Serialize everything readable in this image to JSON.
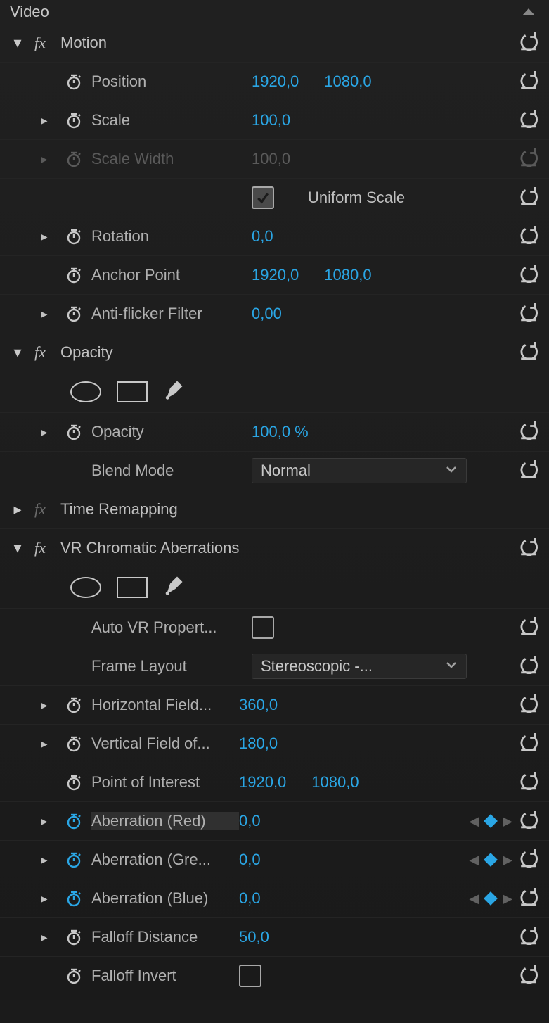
{
  "header": {
    "title": "Video"
  },
  "effects": {
    "motion": {
      "title": "Motion",
      "position": {
        "label": "Position",
        "x": "1920,0",
        "y": "1080,0"
      },
      "scale": {
        "label": "Scale",
        "value": "100,0"
      },
      "scaleWidth": {
        "label": "Scale Width",
        "value": "100,0"
      },
      "uniformScale": {
        "label": "Uniform Scale"
      },
      "rotation": {
        "label": "Rotation",
        "value": "0,0"
      },
      "anchor": {
        "label": "Anchor Point",
        "x": "1920,0",
        "y": "1080,0"
      },
      "antiFlicker": {
        "label": "Anti-flicker Filter",
        "value": "0,00"
      }
    },
    "opacity": {
      "title": "Opacity",
      "opacity": {
        "label": "Opacity",
        "value": "100,0 %"
      },
      "blendMode": {
        "label": "Blend Mode",
        "value": "Normal"
      }
    },
    "timeRemapping": {
      "title": "Time Remapping"
    },
    "vrChroma": {
      "title": "VR Chromatic Aberrations",
      "autoVR": {
        "label": "Auto VR Propert..."
      },
      "frameLayout": {
        "label": "Frame Layout",
        "value": "Stereoscopic -..."
      },
      "hFov": {
        "label": "Horizontal Field...",
        "value": "360,0"
      },
      "vFov": {
        "label": "Vertical Field of...",
        "value": "180,0"
      },
      "poi": {
        "label": "Point of Interest",
        "x": "1920,0",
        "y": "1080,0"
      },
      "abRed": {
        "label": "Aberration (Red)",
        "value": "0,0"
      },
      "abGreen": {
        "label": "Aberration (Gre...",
        "value": "0,0"
      },
      "abBlue": {
        "label": "Aberration (Blue)",
        "value": "0,0"
      },
      "falloffDist": {
        "label": "Falloff Distance",
        "value": "50,0"
      },
      "falloffInvert": {
        "label": "Falloff Invert"
      }
    }
  }
}
